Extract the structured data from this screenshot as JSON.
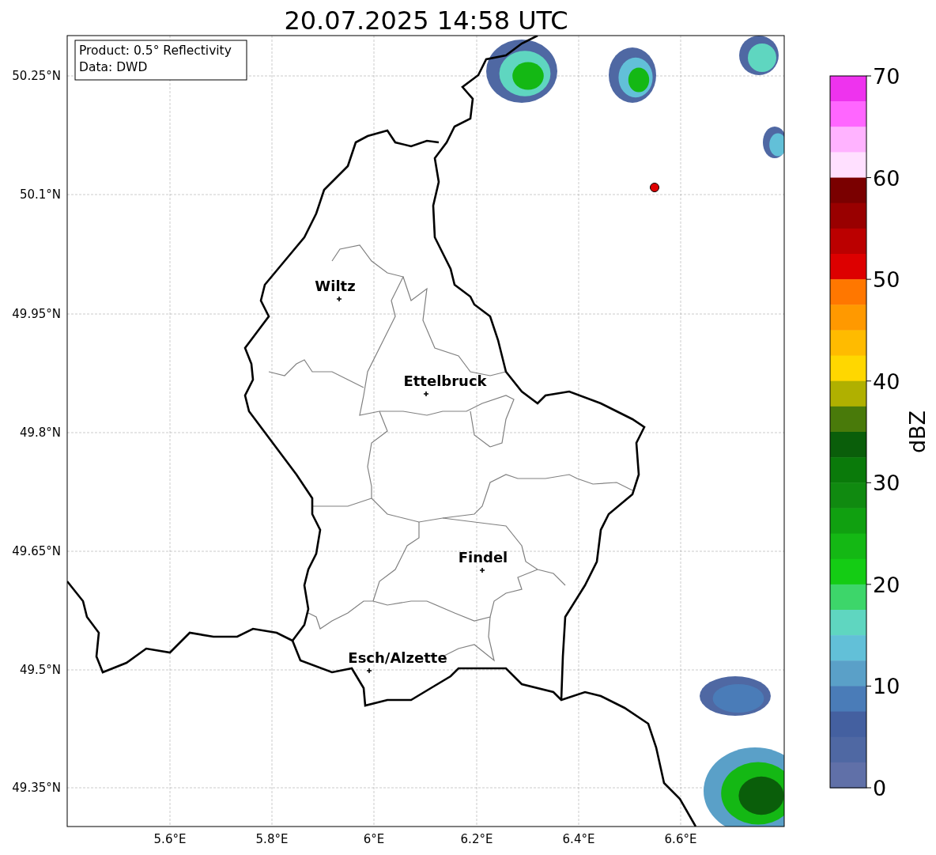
{
  "title": "20.07.2025 14:58 UTC",
  "info_box": {
    "lines": [
      "Product: 0.5° Reflectivity",
      "Data: DWD"
    ]
  },
  "map": {
    "yticks": [
      "50.25°N",
      "50.1°N",
      "49.95°N",
      "49.8°N",
      "49.65°N",
      "49.5°N",
      "49.35°N"
    ],
    "xticks": [
      "5.6°E",
      "5.8°E",
      "6°E",
      "6.2°E",
      "6.4°E",
      "6.6°E"
    ],
    "places": [
      {
        "name": "Wiltz"
      },
      {
        "name": "Ettelbruck"
      },
      {
        "name": "Findel"
      },
      {
        "name": "Esch/Alzette"
      }
    ]
  },
  "colorbar": {
    "label": "dBZ",
    "ticks": [
      "70",
      "60",
      "50",
      "40",
      "30",
      "20",
      "10",
      "0"
    ],
    "segments": [
      {
        "color": "#ee33ee"
      },
      {
        "color": "#ff66ff"
      },
      {
        "color": "#ffb3ff"
      },
      {
        "color": "#ffe0ff"
      },
      {
        "color": "#7a0000"
      },
      {
        "color": "#990000"
      },
      {
        "color": "#bb0000"
      },
      {
        "color": "#dd0000"
      },
      {
        "color": "#ff7700"
      },
      {
        "color": "#ff9900"
      },
      {
        "color": "#ffbb00"
      },
      {
        "color": "#ffd700"
      },
      {
        "color": "#b0b000"
      },
      {
        "color": "#497a0a"
      },
      {
        "color": "#0a5e0a"
      },
      {
        "color": "#0a7a0a"
      },
      {
        "color": "#108a10"
      },
      {
        "color": "#10a010"
      },
      {
        "color": "#14b814"
      },
      {
        "color": "#14cc14"
      },
      {
        "color": "#3dd66a"
      },
      {
        "color": "#5fd6c0"
      },
      {
        "color": "#62c0d8"
      },
      {
        "color": "#5aa0c8"
      },
      {
        "color": "#4a7cb8"
      },
      {
        "color": "#4460a0"
      },
      {
        "color": "#4f68a3"
      },
      {
        "color": "#6070a8"
      }
    ]
  }
}
